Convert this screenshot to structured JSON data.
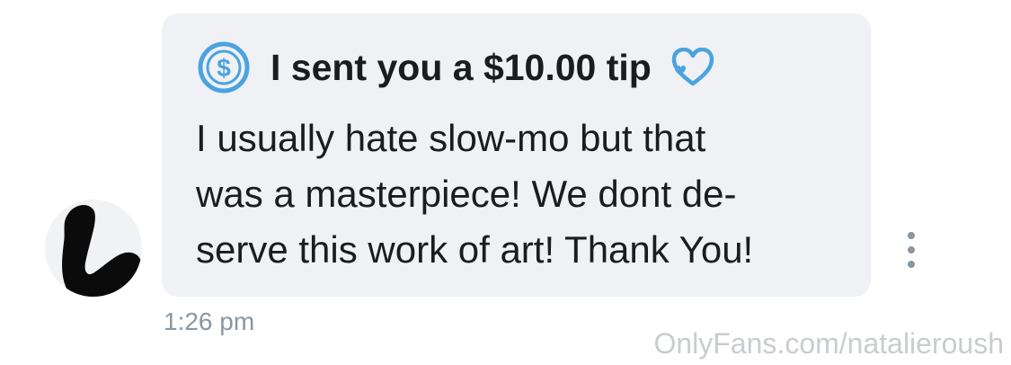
{
  "colors": {
    "bubble_background": "#eff1f4",
    "accent_blue": "#4aa3df",
    "text_primary": "#1b1c1f",
    "text_muted": "#8a96a3",
    "watermark": "#c9ccd1"
  },
  "avatar": {
    "icon": "avatar-redacted"
  },
  "tip": {
    "icon": "dollar-circle-icon",
    "label": "I sent you a $10.00 tip",
    "trailing_icon": "heart-outline-icon"
  },
  "message": {
    "lines": [
      "I usually hate slow-mo but that",
      "was a masterpiece! We dont de-",
      "serve this work of art! Thank You!"
    ]
  },
  "more_menu": {
    "icon": "vertical-ellipsis-icon"
  },
  "timestamp": "1:26 pm",
  "watermark": "OnlyFans.com/natalieroush"
}
